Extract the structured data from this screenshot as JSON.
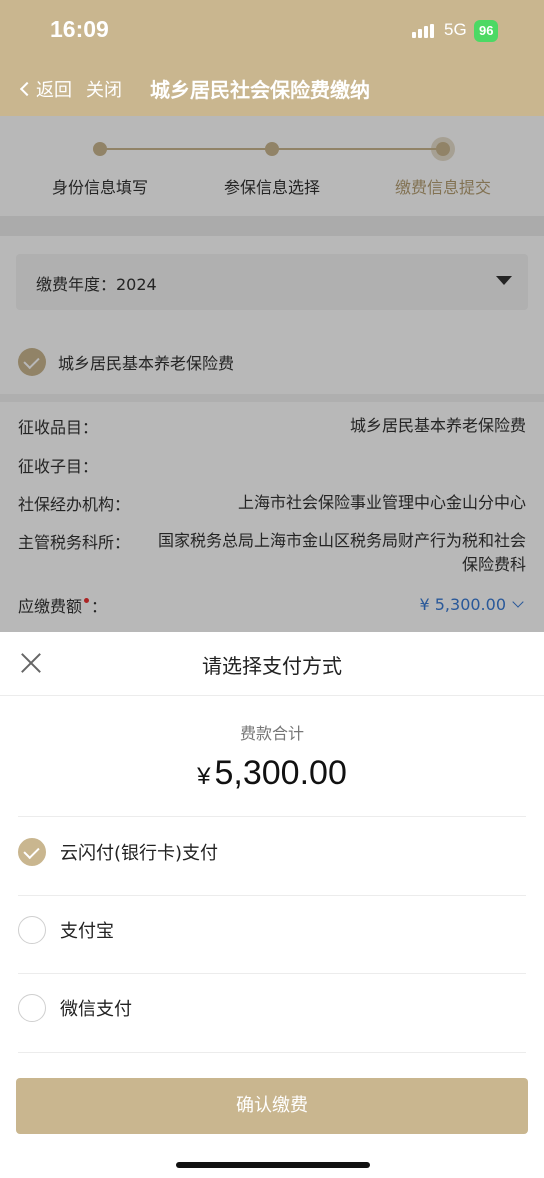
{
  "status_bar": {
    "time": "16:09",
    "network": "5G",
    "battery": "96"
  },
  "nav": {
    "back_label": "返回",
    "close_label": "关闭",
    "title": "城乡居民社会保险费缴纳"
  },
  "steps": [
    {
      "label": "身份信息填写"
    },
    {
      "label": "参保信息选择"
    },
    {
      "label": "缴费信息提交"
    }
  ],
  "form": {
    "year_label": "缴费年度：2024",
    "checkbox_label": "城乡居民基本养老保险费",
    "rows": [
      {
        "key": "征收品目：",
        "value": "城乡居民基本养老保险费"
      },
      {
        "key": "征收子目：",
        "value": ""
      },
      {
        "key": "社保经办机构：",
        "value": "上海市社会保险事业管理中心金山分中心"
      },
      {
        "key": "主管税务科所：",
        "value": "国家税务总局上海市金山区税务局财产行为税和社会保险费科"
      }
    ],
    "amount_key": "应缴费额",
    "amount_colon": "：",
    "amount_value": "¥ 5,300.00"
  },
  "sheet": {
    "title": "请选择支付方式",
    "total_label": "费款合计",
    "currency": "¥",
    "total_amount": "5,300.00",
    "options": [
      {
        "label": "云闪付(银行卡)支付",
        "checked": true
      },
      {
        "label": "支付宝",
        "checked": false
      },
      {
        "label": "微信支付",
        "checked": false
      }
    ],
    "confirm_label": "确认缴费"
  },
  "colors": {
    "accent": "#c9b68f",
    "link": "#3a7bd5"
  }
}
